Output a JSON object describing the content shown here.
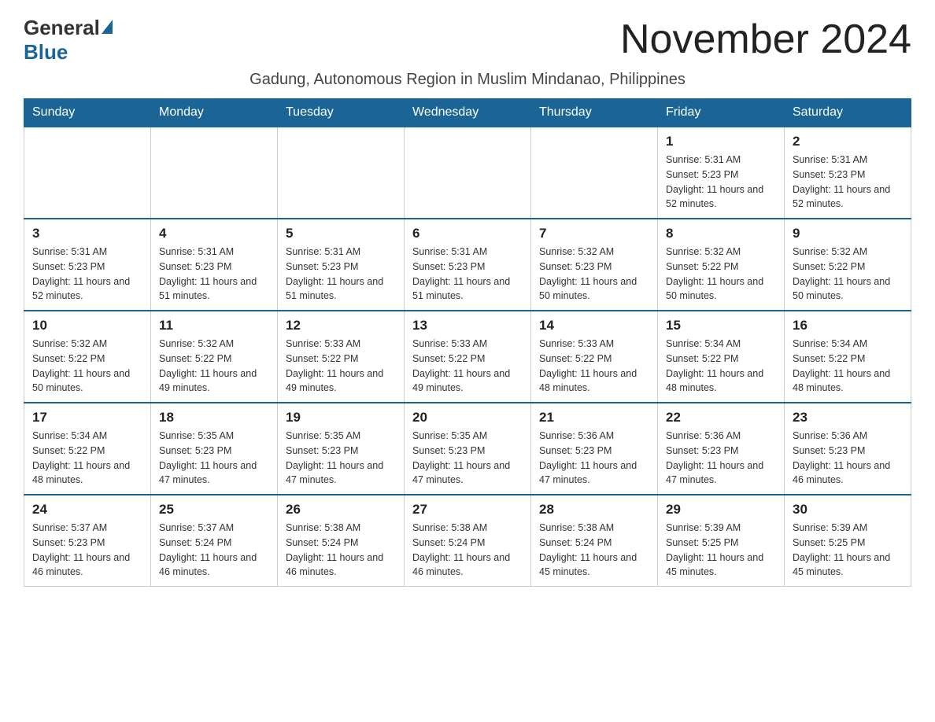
{
  "logo": {
    "general": "General",
    "blue": "Blue"
  },
  "title": "November 2024",
  "subtitle": "Gadung, Autonomous Region in Muslim Mindanao, Philippines",
  "days_header": [
    "Sunday",
    "Monday",
    "Tuesday",
    "Wednesday",
    "Thursday",
    "Friday",
    "Saturday"
  ],
  "weeks": [
    [
      {
        "day": "",
        "info": ""
      },
      {
        "day": "",
        "info": ""
      },
      {
        "day": "",
        "info": ""
      },
      {
        "day": "",
        "info": ""
      },
      {
        "day": "",
        "info": ""
      },
      {
        "day": "1",
        "info": "Sunrise: 5:31 AM\nSunset: 5:23 PM\nDaylight: 11 hours and 52 minutes."
      },
      {
        "day": "2",
        "info": "Sunrise: 5:31 AM\nSunset: 5:23 PM\nDaylight: 11 hours and 52 minutes."
      }
    ],
    [
      {
        "day": "3",
        "info": "Sunrise: 5:31 AM\nSunset: 5:23 PM\nDaylight: 11 hours and 52 minutes."
      },
      {
        "day": "4",
        "info": "Sunrise: 5:31 AM\nSunset: 5:23 PM\nDaylight: 11 hours and 51 minutes."
      },
      {
        "day": "5",
        "info": "Sunrise: 5:31 AM\nSunset: 5:23 PM\nDaylight: 11 hours and 51 minutes."
      },
      {
        "day": "6",
        "info": "Sunrise: 5:31 AM\nSunset: 5:23 PM\nDaylight: 11 hours and 51 minutes."
      },
      {
        "day": "7",
        "info": "Sunrise: 5:32 AM\nSunset: 5:23 PM\nDaylight: 11 hours and 50 minutes."
      },
      {
        "day": "8",
        "info": "Sunrise: 5:32 AM\nSunset: 5:22 PM\nDaylight: 11 hours and 50 minutes."
      },
      {
        "day": "9",
        "info": "Sunrise: 5:32 AM\nSunset: 5:22 PM\nDaylight: 11 hours and 50 minutes."
      }
    ],
    [
      {
        "day": "10",
        "info": "Sunrise: 5:32 AM\nSunset: 5:22 PM\nDaylight: 11 hours and 50 minutes."
      },
      {
        "day": "11",
        "info": "Sunrise: 5:32 AM\nSunset: 5:22 PM\nDaylight: 11 hours and 49 minutes."
      },
      {
        "day": "12",
        "info": "Sunrise: 5:33 AM\nSunset: 5:22 PM\nDaylight: 11 hours and 49 minutes."
      },
      {
        "day": "13",
        "info": "Sunrise: 5:33 AM\nSunset: 5:22 PM\nDaylight: 11 hours and 49 minutes."
      },
      {
        "day": "14",
        "info": "Sunrise: 5:33 AM\nSunset: 5:22 PM\nDaylight: 11 hours and 48 minutes."
      },
      {
        "day": "15",
        "info": "Sunrise: 5:34 AM\nSunset: 5:22 PM\nDaylight: 11 hours and 48 minutes."
      },
      {
        "day": "16",
        "info": "Sunrise: 5:34 AM\nSunset: 5:22 PM\nDaylight: 11 hours and 48 minutes."
      }
    ],
    [
      {
        "day": "17",
        "info": "Sunrise: 5:34 AM\nSunset: 5:22 PM\nDaylight: 11 hours and 48 minutes."
      },
      {
        "day": "18",
        "info": "Sunrise: 5:35 AM\nSunset: 5:23 PM\nDaylight: 11 hours and 47 minutes."
      },
      {
        "day": "19",
        "info": "Sunrise: 5:35 AM\nSunset: 5:23 PM\nDaylight: 11 hours and 47 minutes."
      },
      {
        "day": "20",
        "info": "Sunrise: 5:35 AM\nSunset: 5:23 PM\nDaylight: 11 hours and 47 minutes."
      },
      {
        "day": "21",
        "info": "Sunrise: 5:36 AM\nSunset: 5:23 PM\nDaylight: 11 hours and 47 minutes."
      },
      {
        "day": "22",
        "info": "Sunrise: 5:36 AM\nSunset: 5:23 PM\nDaylight: 11 hours and 47 minutes."
      },
      {
        "day": "23",
        "info": "Sunrise: 5:36 AM\nSunset: 5:23 PM\nDaylight: 11 hours and 46 minutes."
      }
    ],
    [
      {
        "day": "24",
        "info": "Sunrise: 5:37 AM\nSunset: 5:23 PM\nDaylight: 11 hours and 46 minutes."
      },
      {
        "day": "25",
        "info": "Sunrise: 5:37 AM\nSunset: 5:24 PM\nDaylight: 11 hours and 46 minutes."
      },
      {
        "day": "26",
        "info": "Sunrise: 5:38 AM\nSunset: 5:24 PM\nDaylight: 11 hours and 46 minutes."
      },
      {
        "day": "27",
        "info": "Sunrise: 5:38 AM\nSunset: 5:24 PM\nDaylight: 11 hours and 46 minutes."
      },
      {
        "day": "28",
        "info": "Sunrise: 5:38 AM\nSunset: 5:24 PM\nDaylight: 11 hours and 45 minutes."
      },
      {
        "day": "29",
        "info": "Sunrise: 5:39 AM\nSunset: 5:25 PM\nDaylight: 11 hours and 45 minutes."
      },
      {
        "day": "30",
        "info": "Sunrise: 5:39 AM\nSunset: 5:25 PM\nDaylight: 11 hours and 45 minutes."
      }
    ]
  ]
}
